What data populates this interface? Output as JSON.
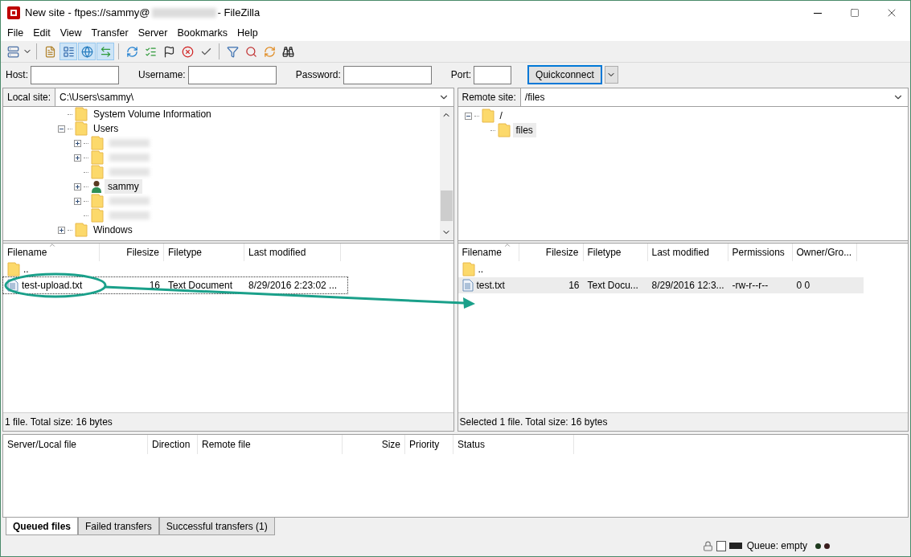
{
  "window": {
    "title_start": "New site - ftpes://sammy@",
    "title_end": "- FileZilla"
  },
  "menu": [
    "File",
    "Edit",
    "View",
    "Transfer",
    "Server",
    "Bookmarks",
    "Help"
  ],
  "toolbar": [
    {
      "kind": "site",
      "selected": false
    },
    {
      "kind": "sep"
    },
    {
      "kind": "log",
      "selected": false
    },
    {
      "kind": "tree",
      "selected": true
    },
    {
      "kind": "globe",
      "selected": true
    },
    {
      "kind": "queue",
      "selected": true
    },
    {
      "kind": "sep"
    },
    {
      "kind": "refresh",
      "selected": false
    },
    {
      "kind": "process",
      "selected": false
    },
    {
      "kind": "flag",
      "selected": false
    },
    {
      "kind": "cancel",
      "selected": false
    },
    {
      "kind": "check",
      "selected": false
    },
    {
      "kind": "sep"
    },
    {
      "kind": "filter",
      "selected": false
    },
    {
      "kind": "search",
      "selected": false
    },
    {
      "kind": "sync",
      "selected": false
    },
    {
      "kind": "binoculars",
      "selected": false
    }
  ],
  "quickconnect": {
    "fields": [
      {
        "label": "Host:"
      },
      {
        "label": "Username:"
      },
      {
        "label": "Password:"
      },
      {
        "label": "Port:"
      }
    ],
    "button": "Quickconnect"
  },
  "local": {
    "site_label": "Local site:",
    "path": "C:\\Users\\sammy\\",
    "tree": [
      {
        "kind": "folder",
        "label": "System Volume Information",
        "selected": false
      },
      {
        "kind": "folder",
        "label": "Users",
        "expanded": true,
        "selected": false,
        "children": [
          {
            "kind": "folder",
            "expanded": false,
            "selected": false,
            "redacted": true
          },
          {
            "kind": "folder",
            "expanded": false,
            "selected": false,
            "redacted": true
          },
          {
            "kind": "folder",
            "selected": false,
            "redacted": true
          },
          {
            "kind": "user",
            "label": "sammy",
            "expanded": false,
            "selected": true,
            "redacted": false
          },
          {
            "kind": "folder",
            "expanded": false,
            "selected": false,
            "redacted": true
          },
          {
            "kind": "folder",
            "selected": false,
            "redacted": true
          }
        ]
      },
      {
        "kind": "folder",
        "label": "Windows",
        "expanded": false,
        "selected": false
      }
    ],
    "columns": [
      "Filename",
      "Filesize",
      "Filetype",
      "Last modified"
    ],
    "rows": [
      {
        "kind": "folder",
        "cells": [
          ".."
        ],
        "selected": false,
        "focused": false
      },
      {
        "kind": "file",
        "cells": [
          "test-upload.txt",
          "16",
          "Text Document",
          "8/29/2016 2:23:02 ..."
        ],
        "selected": false,
        "focused": true
      }
    ],
    "status": "1 file. Total size: 16 bytes"
  },
  "remote": {
    "site_label": "Remote site:",
    "path": "/files",
    "tree": [
      {
        "kind": "folder",
        "label": "/",
        "expanded": true,
        "selected": false,
        "children": [
          {
            "kind": "folder",
            "label": "files",
            "selected": true
          }
        ]
      }
    ],
    "columns": [
      "Filename",
      "Filesize",
      "Filetype",
      "Last modified",
      "Permissions",
      "Owner/Gro..."
    ],
    "rows": [
      {
        "kind": "folder",
        "cells": [
          ".."
        ],
        "selected": false,
        "focused": false
      },
      {
        "kind": "file",
        "cells": [
          "test.txt",
          "16",
          "Text Docu...",
          "8/29/2016 12:3...",
          "-rw-r--r--",
          "0 0"
        ],
        "selected": true,
        "focused": false
      }
    ],
    "status": "Selected 1 file. Total size: 16 bytes"
  },
  "queue": {
    "columns": [
      "Server/Local file",
      "Direction",
      "Remote file",
      "Size",
      "Priority",
      "Status"
    ]
  },
  "tabs": [
    {
      "label": "Queued files",
      "selected": true
    },
    {
      "label": "Failed transfers",
      "selected": false
    },
    {
      "label": "Successful transfers (1)",
      "selected": false
    }
  ],
  "status_bar": {
    "queue": "Queue: empty"
  }
}
